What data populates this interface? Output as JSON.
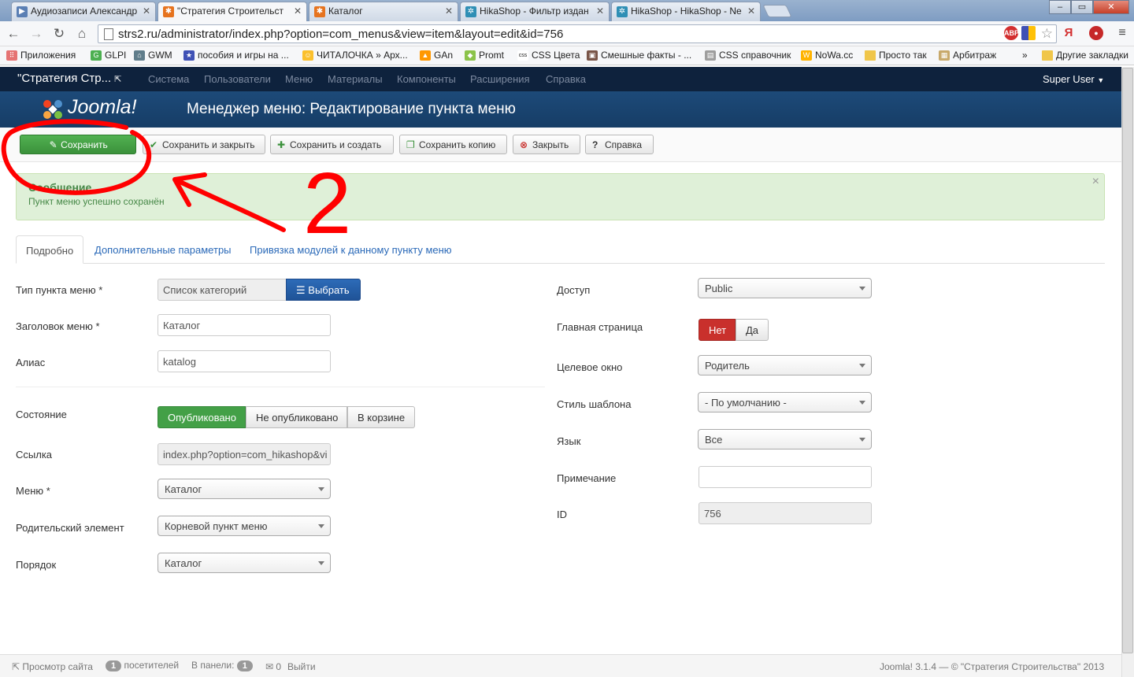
{
  "browser": {
    "tabs": [
      {
        "label": "Аудиозаписи Александр",
        "icon": "play-icon"
      },
      {
        "label": "\"Стратегия Строительст",
        "icon": "joomla-icon"
      },
      {
        "label": "Каталог",
        "icon": "joomla-icon"
      },
      {
        "label": "HikaShop - Фильтр издан",
        "icon": "hikashop-icon"
      },
      {
        "label": "HikaShop - HikaShop - Ne",
        "icon": "hikashop-icon"
      }
    ],
    "url": "strs2.ru/administrator/index.php?option=com_menus&view=item&layout=edit&id=756",
    "bookmarks": [
      "Приложения",
      "GLPI",
      "GWM",
      "пособия и игры на ...",
      "ЧИТАЛОЧКА » Арх...",
      "GAn",
      "Promt",
      "CSS Цвета",
      "Смешные факты - ...",
      "CSS справочник",
      "NoWa.cc",
      "Просто так",
      "Арбитраж",
      "»",
      "Другие закладки"
    ]
  },
  "nav": {
    "site_name": "\"Стратегия Стр...",
    "menu": [
      "Система",
      "Пользователи",
      "Меню",
      "Материалы",
      "Компоненты",
      "Расширения",
      "Справка"
    ],
    "user": "Super User"
  },
  "header": {
    "logo": "Joomla!",
    "title": "Менеджер меню: Редактирование пункта меню"
  },
  "toolbar": {
    "save": "Сохранить",
    "save_close": "Сохранить и закрыть",
    "save_new": "Сохранить и создать",
    "save_copy": "Сохранить копию",
    "close": "Закрыть",
    "help": "Справка"
  },
  "alert": {
    "title": "Сообщение",
    "text": "Пункт меню успешно сохранён"
  },
  "tabs": [
    "Подробно",
    "Дополнительные параметры",
    "Привязка модулей к данному пункту меню"
  ],
  "form_left": {
    "menu_type_label": "Тип пункта меню *",
    "menu_type_value": "Список категорий",
    "select_button": "Выбрать",
    "title_label": "Заголовок меню *",
    "title_value": "Каталог",
    "alias_label": "Алиас",
    "alias_value": "katalog",
    "state_label": "Состояние",
    "state_options": [
      "Опубликовано",
      "Не опубликовано",
      "В корзине"
    ],
    "link_label": "Ссылка",
    "link_value": "index.php?option=com_hikashop&vi",
    "menu_label": "Меню *",
    "menu_value": "Каталог",
    "parent_label": "Родительский элемент",
    "parent_value": "Корневой пункт меню",
    "order_label": "Порядок",
    "order_value": "Каталог"
  },
  "form_right": {
    "access_label": "Доступ",
    "access_value": "Public",
    "home_label": "Главная страница",
    "home_options": [
      "Нет",
      "Да"
    ],
    "target_label": "Целевое окно",
    "target_value": "Родитель",
    "style_label": "Стиль шаблона",
    "style_value": "- По умолчанию -",
    "lang_label": "Язык",
    "lang_value": "Все",
    "note_label": "Примечание",
    "note_value": "",
    "id_label": "ID",
    "id_value": "756"
  },
  "footer": {
    "view_site": "Просмотр сайта",
    "visitors_count": "1",
    "visitors_label": "посетителей",
    "admin_label": "В панели:",
    "admin_count": "1",
    "messages_count": "0",
    "logout": "Выйти",
    "copyright": "Joomla! 3.1.4 — © \"Стратегия Строительства\" 2013"
  },
  "annotation": {
    "label": "2",
    "color": "#ff0000"
  }
}
